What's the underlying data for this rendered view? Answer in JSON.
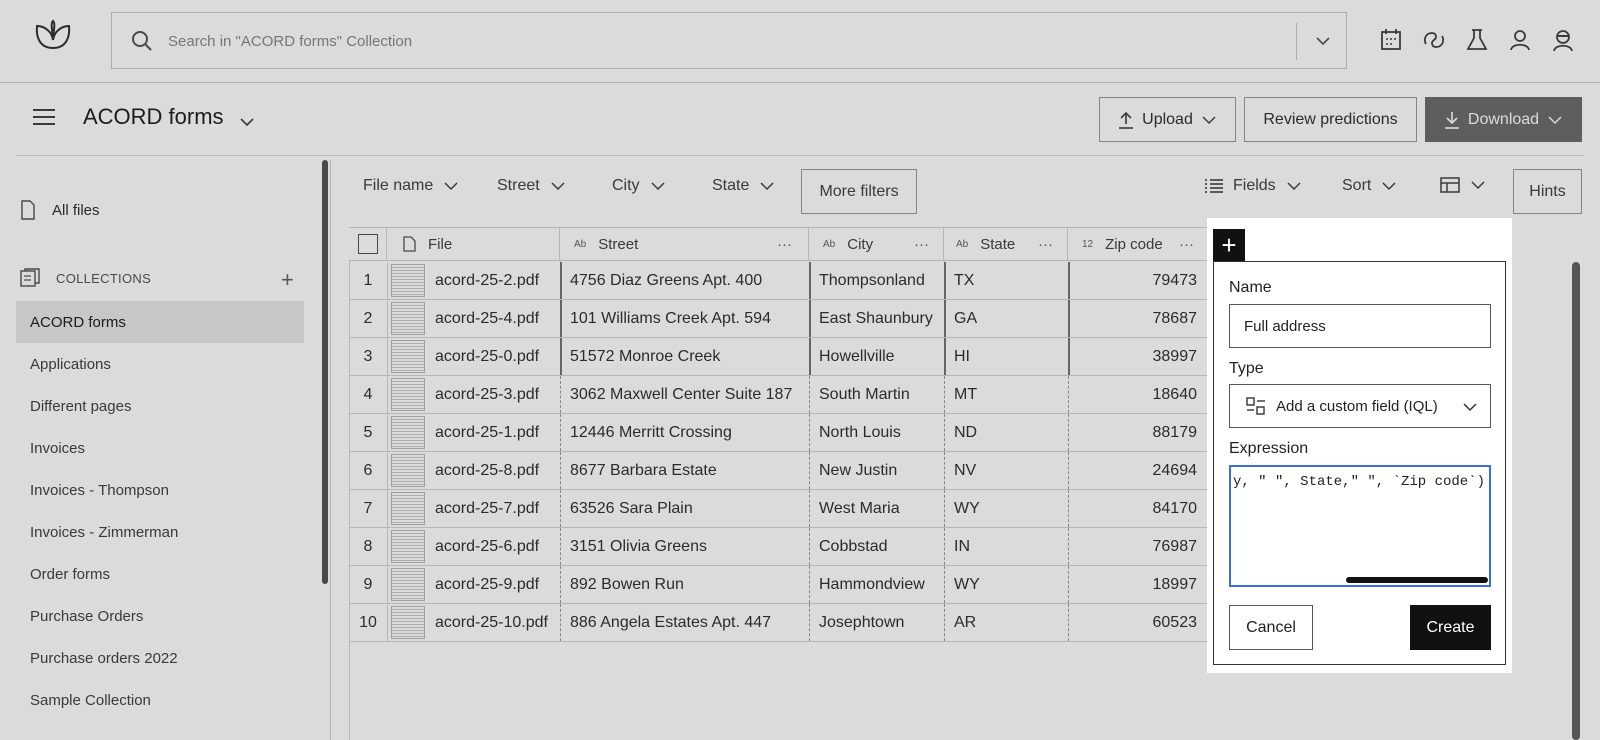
{
  "search": {
    "placeholder": "Search in \"ACORD forms\" Collection"
  },
  "header": {
    "collection_title": "ACORD forms",
    "upload_label": "Upload",
    "review_label": "Review predictions",
    "download_label": "Download"
  },
  "top_icons": [
    "calendar-icon",
    "chat-ai-icon",
    "flask-icon",
    "user-icon",
    "profile-avatar-icon"
  ],
  "sidebar": {
    "all_files": "All files",
    "collections_heading": "COLLECTIONS",
    "items": [
      "ACORD forms",
      "Applications",
      "Different pages",
      "Invoices",
      "Invoices - Thompson",
      "Invoices - Zimmerman",
      "Order forms",
      "Purchase Orders",
      "Purchase orders 2022",
      "Sample Collection"
    ],
    "active_index": 0
  },
  "filters": {
    "file_name": "File name",
    "street": "Street",
    "city": "City",
    "state": "State",
    "more": "More filters",
    "fields": "Fields",
    "sort": "Sort",
    "hints": "Hints"
  },
  "table": {
    "columns": {
      "file": "File",
      "street": "Street",
      "city": "City",
      "state": "State",
      "zip": "Zip code",
      "text_type_tag": "Ab",
      "number_type_tag": "12",
      "more": "···"
    },
    "rows": [
      {
        "n": "1",
        "file": "acord-25-2.pdf",
        "street": "4756 Diaz Greens Apt. 400",
        "city": "Thompsonland",
        "state": "TX",
        "zip": "79473"
      },
      {
        "n": "2",
        "file": "acord-25-4.pdf",
        "street": "101 Williams Creek Apt. 594",
        "city": "East Shaunbury",
        "state": "GA",
        "zip": "78687"
      },
      {
        "n": "3",
        "file": "acord-25-0.pdf",
        "street": "51572 Monroe Creek",
        "city": "Howellville",
        "state": "HI",
        "zip": "38997"
      },
      {
        "n": "4",
        "file": "acord-25-3.pdf",
        "street": "3062 Maxwell Center Suite 187",
        "city": "South Martin",
        "state": "MT",
        "zip": "18640"
      },
      {
        "n": "5",
        "file": "acord-25-1.pdf",
        "street": "12446 Merritt Crossing",
        "city": "North Louis",
        "state": "ND",
        "zip": "88179"
      },
      {
        "n": "6",
        "file": "acord-25-8.pdf",
        "street": "8677 Barbara Estate",
        "city": "New Justin",
        "state": "NV",
        "zip": "24694"
      },
      {
        "n": "7",
        "file": "acord-25-7.pdf",
        "street": "63526 Sara Plain",
        "city": "West Maria",
        "state": "WY",
        "zip": "84170"
      },
      {
        "n": "8",
        "file": "acord-25-6.pdf",
        "street": "3151 Olivia Greens",
        "city": "Cobbstad",
        "state": "IN",
        "zip": "76987"
      },
      {
        "n": "9",
        "file": "acord-25-9.pdf",
        "street": "892 Bowen Run",
        "city": "Hammondview",
        "state": "WY",
        "zip": "18997"
      },
      {
        "n": "10",
        "file": "acord-25-10.pdf",
        "street": "886 Angela Estates Apt. 447",
        "city": "Josephtown",
        "state": "AR",
        "zip": "60523"
      }
    ]
  },
  "popup": {
    "tab_symbol": "+",
    "name_label": "Name",
    "name_value": "Full address",
    "type_label": "Type",
    "type_value": "Add a custom field (IQL)",
    "expression_label": "Expression",
    "expression_value": "y, \" \", State,\" \", `Zip code`)",
    "cancel_label": "Cancel",
    "create_label": "Create"
  },
  "colors": {
    "accent_focus": "#3b6fd4",
    "download_button": "#6e6e6e",
    "create_button": "#111111"
  }
}
